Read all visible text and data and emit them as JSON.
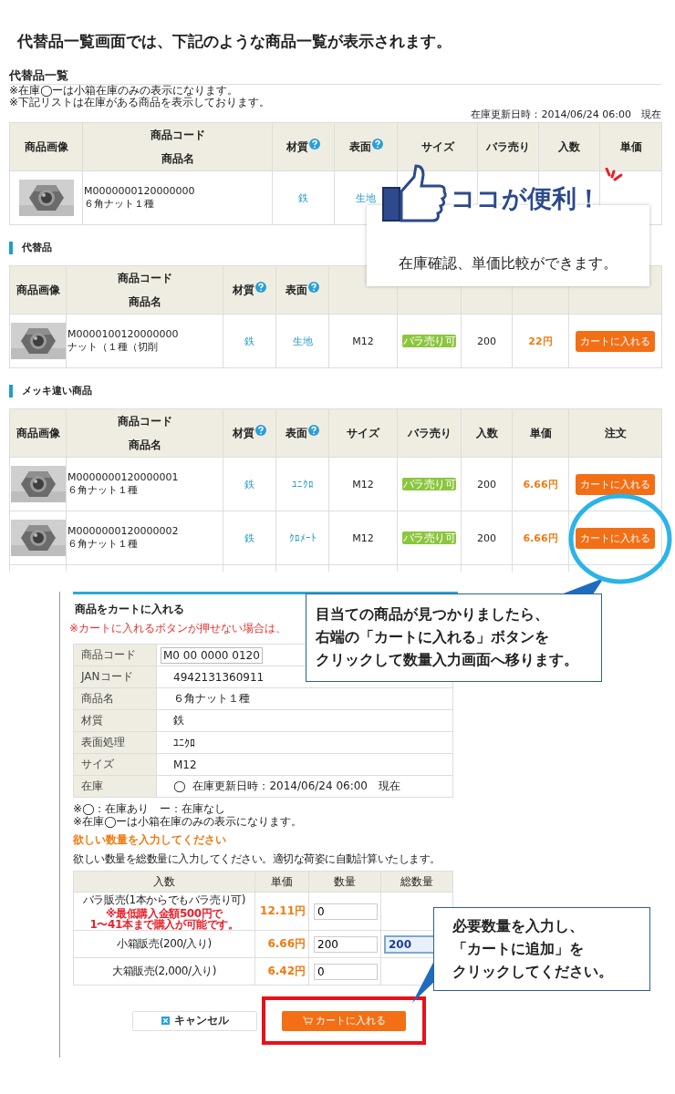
{
  "heading": "代替品一覧画面では、下記のような商品一覧が表示されます。",
  "list_page": {
    "title": "代替品一覧",
    "notes": [
      "※在庫◯ーは小箱在庫のみの表示になります。",
      "※下記リストは在庫がある商品を表示しております。"
    ],
    "stock_updated": "在庫更新日時：2014/06/24 06:00　現在",
    "tables": [
      {
        "columns": [
          {
            "label": "商品画像"
          },
          {
            "kind": "product",
            "label": "商品コード",
            "sublabel": "商品名"
          },
          {
            "kind": "material",
            "label": "材質",
            "help": true
          },
          {
            "kind": "surface",
            "label": "表面",
            "help": true
          },
          {
            "kind": "size",
            "label": "サイズ"
          },
          {
            "kind": "bulk",
            "label": "バラ売り"
          },
          {
            "kind": "count",
            "label": "入数"
          },
          {
            "kind": "price",
            "label": "単価"
          }
        ],
        "rows": [
          {
            "code": "M0000000120000000",
            "name": "６角ナット１種",
            "material": "鉄",
            "surface": "生地"
          }
        ]
      },
      {
        "title": "代替品",
        "columns": [
          {
            "label": "商品画像"
          },
          {
            "kind": "product",
            "label": "商品コード",
            "sublabel": "商品名"
          },
          {
            "kind": "material",
            "label": "材質",
            "help": true
          },
          {
            "kind": "surface",
            "label": "表面",
            "help": true
          },
          {
            "kind": "size"
          },
          {
            "kind": "bulk"
          },
          {
            "kind": "count"
          },
          {
            "kind": "price"
          },
          {
            "kind": "order"
          }
        ],
        "rows": [
          {
            "code": "M0000100120000000",
            "name": "ナット（１種（切削",
            "material": "鉄",
            "surface": "生地",
            "size": "M12",
            "bulk": "バラ売り可",
            "count": "200",
            "price": "22円",
            "order": "カートに入れる"
          }
        ]
      },
      {
        "title": "メッキ違い商品",
        "columns": [
          {
            "label": "商品画像"
          },
          {
            "kind": "product",
            "label": "商品コード",
            "sublabel": "商品名"
          },
          {
            "kind": "material",
            "label": "材質",
            "help": true
          },
          {
            "kind": "surface",
            "label": "表面",
            "help": true
          },
          {
            "kind": "size",
            "label": "サイズ"
          },
          {
            "kind": "bulk",
            "label": "バラ売り"
          },
          {
            "kind": "count",
            "label": "入数"
          },
          {
            "kind": "price",
            "label": "単価"
          },
          {
            "kind": "order",
            "label": "注文"
          }
        ],
        "rows": [
          {
            "code": "M0000000120000001",
            "name": "６角ナット１種",
            "material": "鉄",
            "surface": "ﾕﾆｸﾛ",
            "size": "M12",
            "bulk": "バラ売り可",
            "count": "200",
            "price": "6.66円",
            "order": "カートに入れる"
          },
          {
            "code": "M0000000120000002",
            "name": "６角ナット１種",
            "material": "鉄",
            "surface": "ｸﾛﾒｰﾄ",
            "size": "M12",
            "bulk": "バラ売り可",
            "count": "200",
            "price": "6.66円",
            "order": "カートに入れる"
          }
        ]
      }
    ]
  },
  "callout_convenient": {
    "banner": "ココが便利！",
    "text": "在庫確認、単価比較ができます。"
  },
  "cart_page": {
    "title": "商品をカートに入れる",
    "warning": "※カートに入れるボタンが押せない場合は、",
    "details": [
      {
        "kind": "field",
        "label": "商品コード",
        "value": "M0 00 0000 0120"
      },
      {
        "kind": "text",
        "label": "JANコード",
        "value": "4942131360911"
      },
      {
        "kind": "text",
        "label": "商品名",
        "value": "６角ナット１種"
      },
      {
        "kind": "text",
        "label": "材質",
        "value": "鉄"
      },
      {
        "kind": "text",
        "label": "表面処理",
        "value": "ﾕﾆｸﾛ"
      },
      {
        "kind": "text",
        "label": "サイズ",
        "value": "M12"
      },
      {
        "kind": "stock",
        "label": "在庫",
        "mark": "◯",
        "value": "在庫更新日時：2014/06/24 06:00　現在"
      }
    ],
    "notes": [
      "※◯：在庫あり　ー：在庫なし",
      "※在庫◯ーは小箱在庫のみの表示になります。"
    ],
    "quantity_heading": "欲しい数量を入力してください",
    "quantity_hint": "欲しい数量を総数量に入力してください。適切な荷姿に自動計算いたします。",
    "quantity_table": {
      "columns": [
        "入数",
        "単価",
        "数量",
        "総数量"
      ],
      "rows": [
        {
          "label": "バラ販売(1本からでもバラ売り可)",
          "warning": [
            "※最低購入金額500円で",
            "1〜41本まで購入が可能です。"
          ],
          "price": "12.11円",
          "quantity": "0"
        },
        {
          "label": "小箱販売(200/入り)",
          "price": "6.66円",
          "quantity": "200",
          "total": {
            "value": "200",
            "focused": true
          }
        },
        {
          "label": "大箱販売(2,000/入り)",
          "price": "6.42円",
          "quantity": "0"
        }
      ]
    },
    "buttons": [
      {
        "kind": "cancel",
        "label": "キャンセル",
        "highlighted": false
      },
      {
        "kind": "cart",
        "label": "カートに入れる",
        "highlighted": true
      }
    ]
  },
  "callout_click": {
    "lines": [
      "目当ての商品が見つかりましたら、",
      "右端の「カートに入れる」ボタンを",
      "クリックして数量入力画面へ移ります。"
    ]
  },
  "callout_quantity": {
    "lines": [
      "必要数量を入力し、",
      "「カートに追加」を",
      "クリックしてください。"
    ]
  }
}
